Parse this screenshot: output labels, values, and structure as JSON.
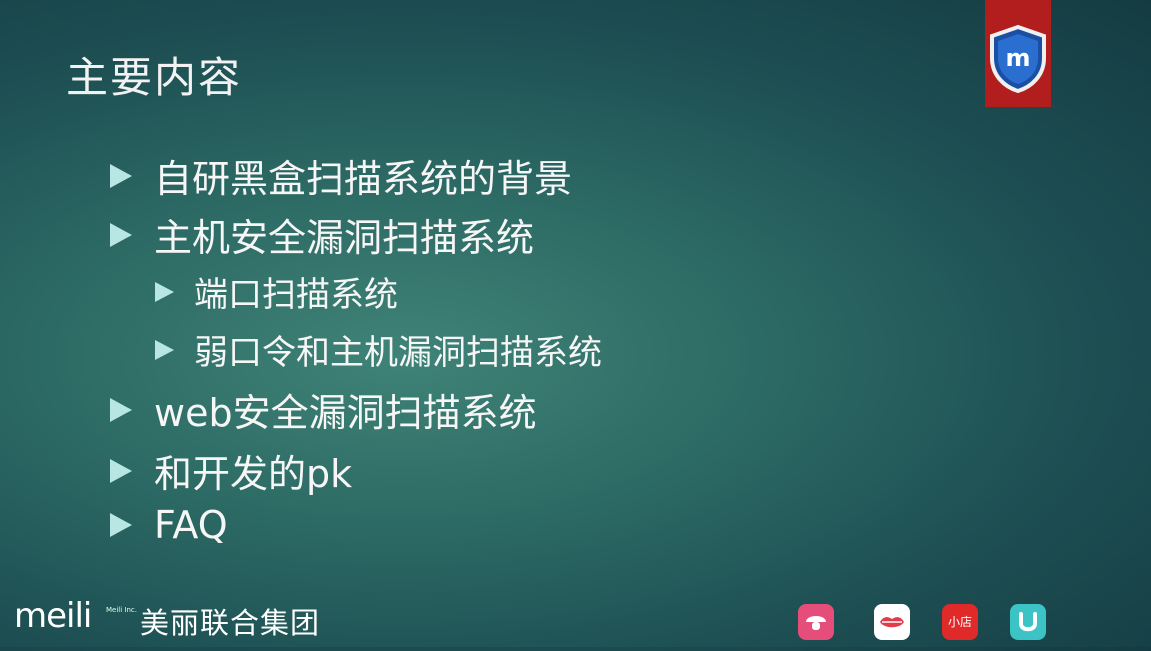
{
  "slide": {
    "title": "主要内容",
    "items": [
      {
        "text": "自研黑盒扫描系统的背景"
      },
      {
        "text": "主机安全漏洞扫描系统"
      },
      {
        "text": "端口扫描系统"
      },
      {
        "text": "弱口令和主机漏洞扫描系统"
      },
      {
        "text": "web安全漏洞扫描系统"
      },
      {
        "text": "和开发的pk"
      },
      {
        "text": "FAQ"
      }
    ]
  },
  "badge": {
    "letter": "m"
  },
  "footer": {
    "logo": "meili",
    "logo_small": "Meili Inc.",
    "company": "美丽联合集团",
    "app_store_label": "小店"
  },
  "colors": {
    "background": "#2c6964",
    "bullet": "#b7e6e3",
    "badge": "#b21d1d"
  }
}
